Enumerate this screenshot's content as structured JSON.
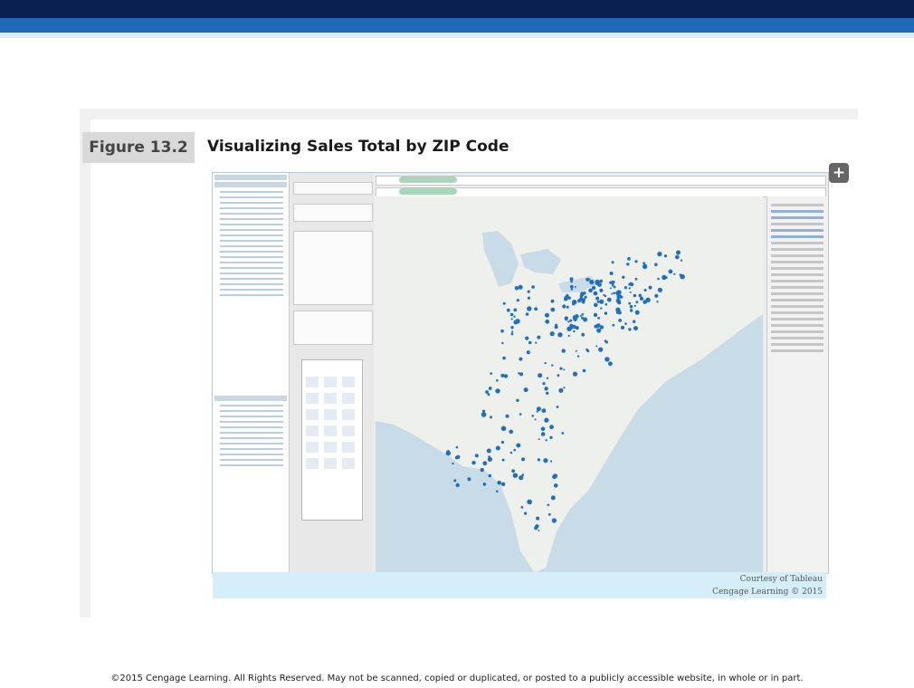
{
  "figure": {
    "label": "Figure 13.2",
    "title": "Visualizing Sales Total by ZIP Code",
    "courtesy_line1": "Courtesy of Tableau",
    "courtesy_line2": "Cengage Learning © 2015"
  },
  "controls": {
    "add_icon": "plus-icon",
    "add_symbol": "+"
  },
  "colors": {
    "header_dark": "#0a2050",
    "header_blue": "#1e6ab8",
    "map_marker": "#1f6fbf",
    "caption_band": "#d6eef9"
  },
  "footer": {
    "copyright": "©2015 Cengage Learning. All Rights Reserved. May not be scanned, copied or duplicated, or posted to a publicly accessible website, in whole or in part."
  }
}
